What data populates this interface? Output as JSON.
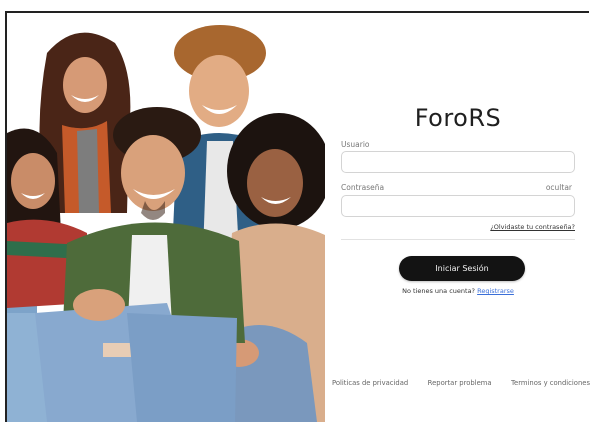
{
  "brand": {
    "name": "ForoRS"
  },
  "hero": {
    "description_icon": "group-photo"
  },
  "form": {
    "username_label": "Usuario",
    "username_value": "",
    "username_placeholder": "",
    "password_label": "Contraseña",
    "password_value": "",
    "password_placeholder": "",
    "toggle_password_label": "ocultar",
    "forgot_password_label": "¿Olvidaste tu contraseña?",
    "submit_label": "Iniciar Sesión",
    "no_account_text": "No tienes una cuenta?",
    "register_link_label": "Registrarse"
  },
  "footer": {
    "links": [
      "Politicas de privacidad",
      "Reportar problema",
      "Terminos y condiciones"
    ]
  },
  "colors": {
    "button_bg": "#131313",
    "button_text": "#f4f4f4",
    "link_blue": "#3b6fd8",
    "field_border": "#d4d4d4"
  }
}
